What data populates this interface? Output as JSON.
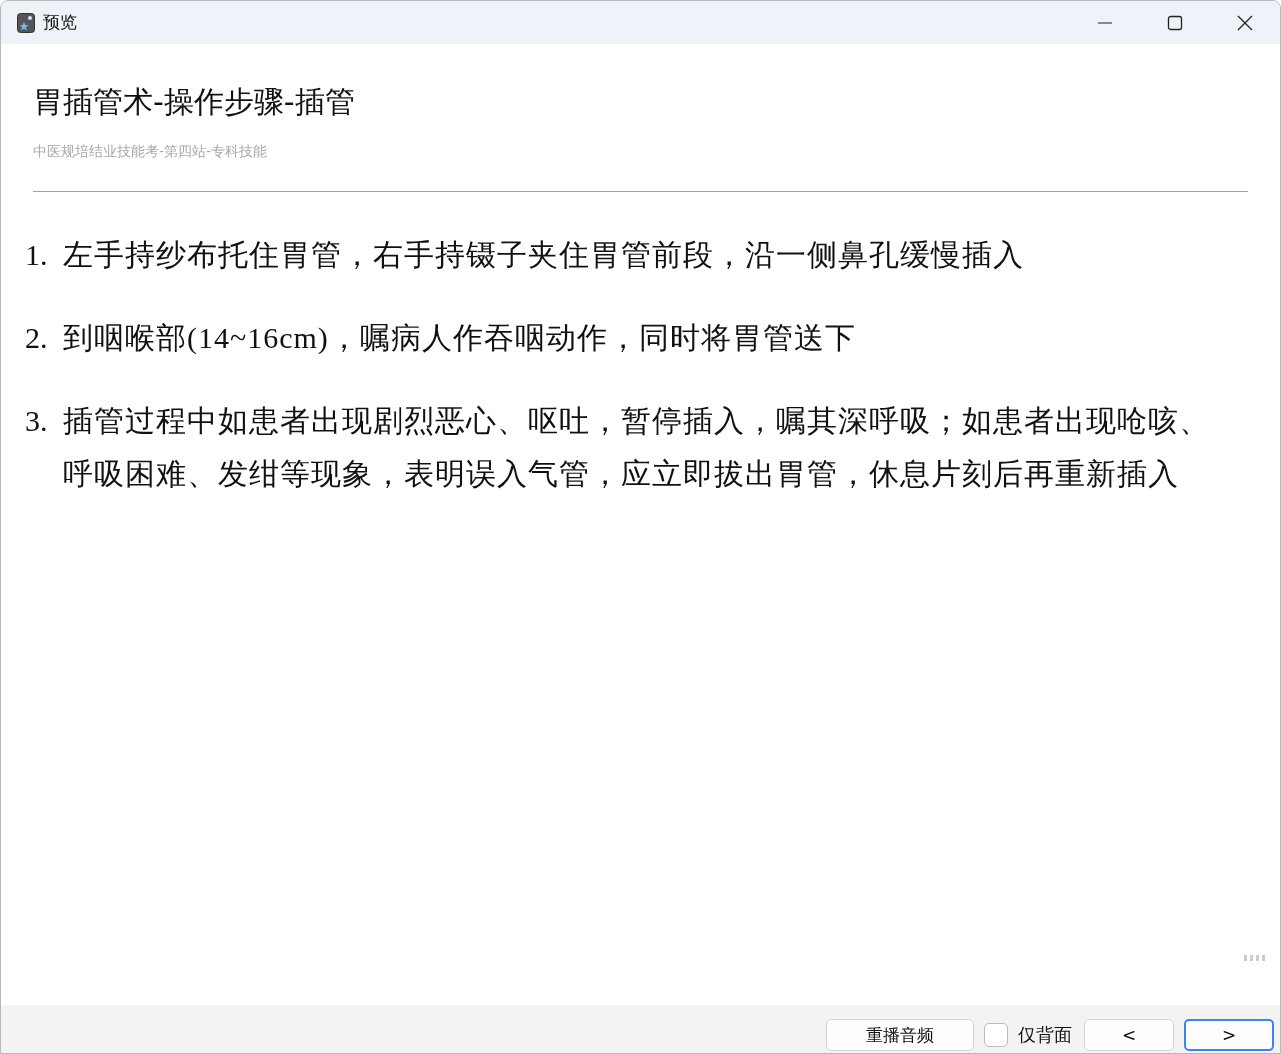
{
  "window": {
    "title": "预览"
  },
  "card": {
    "title": "胃插管术-操作步骤-插管",
    "subtitle": "中医规培结业技能考-第四站-专科技能",
    "steps": [
      {
        "number": "1.",
        "text": "左手持纱布托住胃管，右手持镊子夹住胃管前段，沿一侧鼻孔缓慢插入"
      },
      {
        "number": "2.",
        "text": "到咽喉部(14~16cm)，嘱病人作吞咽动作，同时将胃管送下"
      },
      {
        "number": "3.",
        "text": "插管过程中如患者出现剧烈恶心、呕吐，暂停插入，嘱其深呼吸；如患者出现呛咳、呼吸困难、发绀等现象，表明误入气管，应立即拔出胃管，休息片刻后再重新插入"
      }
    ]
  },
  "footer": [
    {
      "kind": "button",
      "label": "重播音频",
      "focused": false
    },
    {
      "kind": "checkbox",
      "label": "仅背面",
      "checked": false
    },
    {
      "kind": "button",
      "label": "<",
      "focused": false
    },
    {
      "kind": "button",
      "label": ">",
      "focused": true
    }
  ]
}
